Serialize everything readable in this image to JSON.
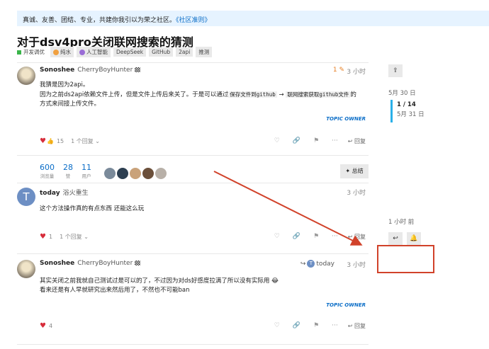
{
  "banner": {
    "text": "真诚、友善、团结、专业，共建你我引以为荣之社区。",
    "link": "《社区准则》"
  },
  "topic": {
    "title": "对于dsv4pro关闭联网搜索的猜测"
  },
  "tags": {
    "category": "开发调优",
    "items": [
      "纯水",
      "人工智能",
      "DeepSeek",
      "GitHub",
      "2api",
      "推测"
    ]
  },
  "posts": [
    {
      "username": "Sonoshee",
      "fullname": "CherryBoyHunter",
      "edit_count": "1",
      "time": "3 小时",
      "line1": "我猜是因为2api。",
      "line2a": "因为之前ds2api依赖文件上传，但是文件上传后来关了。于是可以通过",
      "code1": "保存文件到github",
      "arrow": "→",
      "code2": "联网搜索获取github文件",
      "line2b": "的",
      "line3": "方式来间接上传文件。",
      "owner": "TOPIC OWNER",
      "likes": "15",
      "replies": "1 个回复",
      "reply_label": "回复"
    },
    {
      "username": "today",
      "fullname": "浴火重生",
      "time": "3 小时",
      "text": "这个方法操作真的有点东西 还能这么玩",
      "likes": "1",
      "replies": "1 个回复",
      "reply_label": "回复"
    },
    {
      "username": "Sonoshee",
      "fullname": "CherryBoyHunter",
      "reply_to": "today",
      "time": "3 小时",
      "line1": "其实关闭之前我就自己测试过是可以的了，不过因为对ds好感度拉满了所以没有实际用 😂",
      "line2": "看来还是有人早就研究出来然后用了，不然也不可能ban",
      "owner": "TOPIC OWNER",
      "likes": "4",
      "reply_label": "回复"
    }
  ],
  "stats": {
    "views": "600",
    "views_label": "浏览量",
    "likes": "28",
    "likes_label": "赞",
    "users": "11",
    "users_label": "用户",
    "summary": "总结"
  },
  "timeline": {
    "start_date": "5月 30 日",
    "position": "1 / 14",
    "current_date": "5月 31 日",
    "last": "1 小时 前"
  },
  "colors": {
    "accent": "#0a6dc7",
    "like": "#d72d3b",
    "annotation": "#d1422a"
  }
}
